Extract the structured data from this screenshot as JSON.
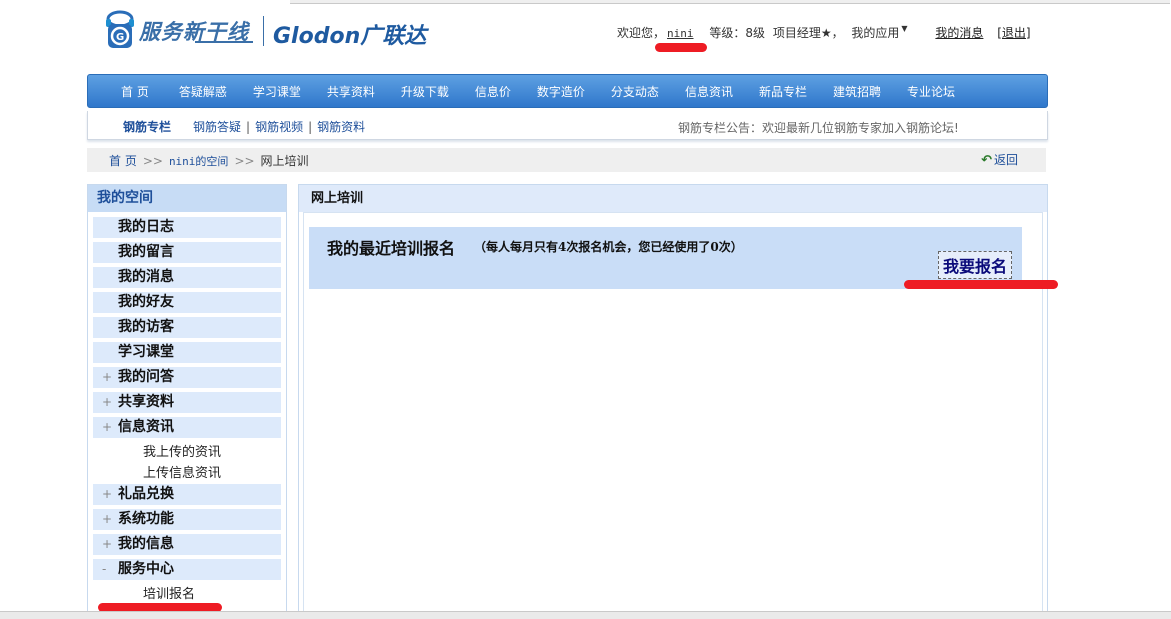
{
  "header": {
    "logo_service_text": "服务新干线",
    "logo_brand_text": "Glodon广联达",
    "welcome": "欢迎您，",
    "username": "nini",
    "level": "等级：8级",
    "title": "项目经理★，",
    "my_apps": "我的应用",
    "my_messages": "我的消息",
    "logout": "[退出]"
  },
  "mainnav": {
    "items": [
      "首 页",
      "答疑解惑",
      "学习课堂",
      "共享资料",
      "升级下载",
      "信息价",
      "数字造价",
      "分支动态",
      "信息资讯",
      "新品专栏",
      "建筑招聘",
      "专业论坛"
    ]
  },
  "subnav": {
    "current": "钢筋专栏",
    "links": [
      "钢筋答疑",
      "钢筋视频",
      "钢筋资料"
    ],
    "notice": "钢筋专栏公告：欢迎最新几位钢筋专家加入钢筋论坛!"
  },
  "breadcrumb": {
    "home": "首 页",
    "sep": ">>",
    "space": "nini的空间",
    "current": "网上培训",
    "back": "返回"
  },
  "sidebar": {
    "title": "我的空间",
    "items": [
      {
        "label": "我的日志",
        "type": "item",
        "pm": ""
      },
      {
        "label": "我的留言",
        "type": "item",
        "pm": ""
      },
      {
        "label": "我的消息",
        "type": "item",
        "pm": ""
      },
      {
        "label": "我的好友",
        "type": "item",
        "pm": ""
      },
      {
        "label": "我的访客",
        "type": "item",
        "pm": ""
      },
      {
        "label": "学习课堂",
        "type": "item",
        "pm": ""
      },
      {
        "label": "我的问答",
        "type": "item",
        "pm": "+"
      },
      {
        "label": "共享资料",
        "type": "item",
        "pm": "+"
      },
      {
        "label": "信息资讯",
        "type": "item",
        "pm": "+"
      },
      {
        "label": "我上传的资讯",
        "type": "sub",
        "pm": ""
      },
      {
        "label": "上传信息资讯",
        "type": "sub",
        "pm": ""
      },
      {
        "label": "礼品兑换",
        "type": "item",
        "pm": "+"
      },
      {
        "label": "系统功能",
        "type": "item",
        "pm": "+"
      },
      {
        "label": "我的信息",
        "type": "item",
        "pm": "+"
      },
      {
        "label": "服务中心",
        "type": "item",
        "pm": "-"
      },
      {
        "label": "培训报名",
        "type": "sub",
        "pm": ""
      }
    ]
  },
  "content": {
    "title": "网上培训",
    "box_title": "我的最近培训报名",
    "box_note": "（每人每月只有4次报名机会，您已经使用了0次）",
    "enroll_button": "我要报名"
  },
  "colors": {
    "nav_blue": "#2f77cb",
    "highlight_red": "#ee1c24",
    "box_blue": "#c9ddf7"
  }
}
